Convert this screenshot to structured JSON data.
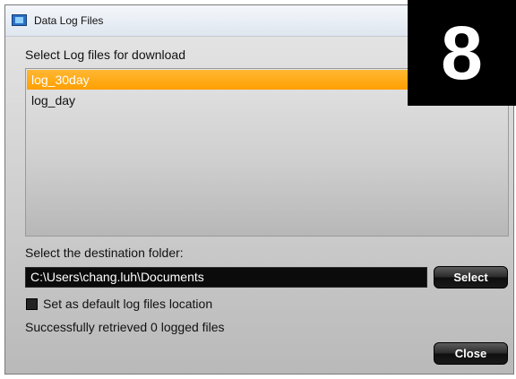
{
  "window": {
    "title": "Data Log Files",
    "app_icon": "application-window-icon"
  },
  "step_badge": "8",
  "files": {
    "heading": "Select Log files for download",
    "items": [
      {
        "label": "log_30day",
        "selected": true
      },
      {
        "label": "log_day",
        "selected": false
      }
    ]
  },
  "destination": {
    "heading": "Select the destination folder:",
    "path": "C:\\Users\\chang.luh\\Documents",
    "select_label": "Select"
  },
  "default_option": {
    "label": "Set as default log files location",
    "checked": false
  },
  "status": "Successfully retrieved 0 logged files",
  "close_label": "Close",
  "colors": {
    "selection": "#ff9f00",
    "badge_bg": "#000000"
  }
}
